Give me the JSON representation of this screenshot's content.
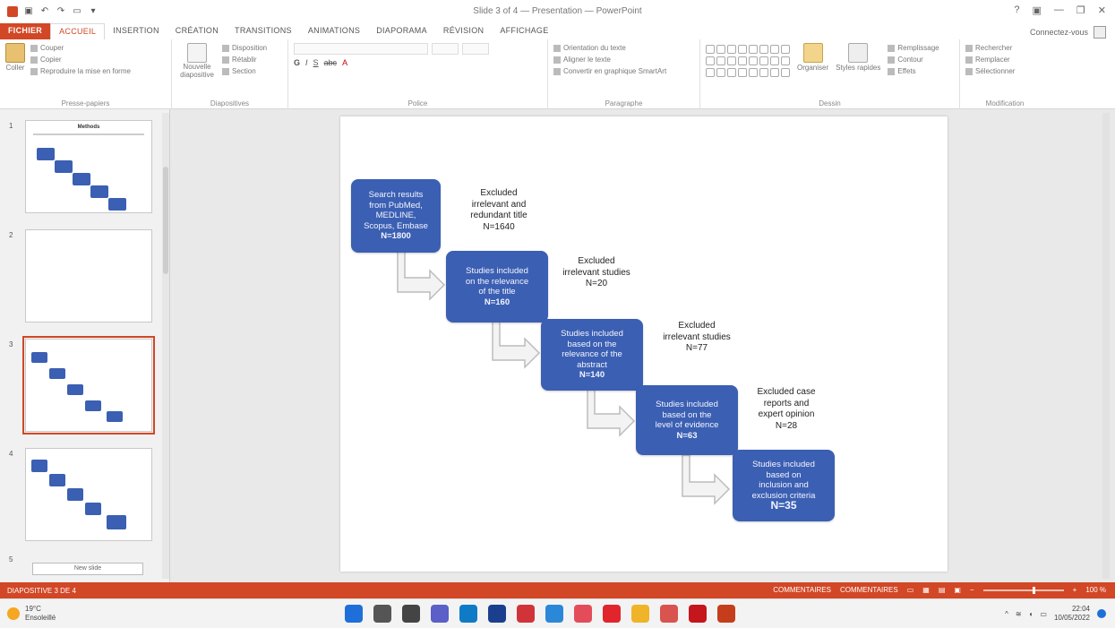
{
  "window": {
    "title": "Slide 3 of 4 — Presentation — PowerPoint",
    "qat": [
      "save-icon",
      "undo-icon",
      "redo-icon",
      "start-icon",
      "customize-icon"
    ],
    "controls": [
      "help-icon",
      "ribbon-options-icon",
      "minimize-icon",
      "restore-icon",
      "close-icon"
    ]
  },
  "tabs": {
    "file": "FICHIER",
    "items": [
      "ACCUEIL",
      "INSERTION",
      "CRÉATION",
      "TRANSITIONS",
      "ANIMATIONS",
      "DIAPORAMA",
      "RÉVISION",
      "AFFICHAGE"
    ],
    "active": "ACCUEIL",
    "account": "Connectez-vous"
  },
  "ribbon": {
    "clipboard": {
      "paste": "Coller",
      "cut": "Couper",
      "copy": "Copier",
      "painter": "Reproduire la mise en forme",
      "label": "Presse-papiers"
    },
    "slides": {
      "new": "Nouvelle diapositive",
      "layout": "Disposition",
      "reset": "Rétablir",
      "section": "Section",
      "label": "Diapositives"
    },
    "font": {
      "label": "Police"
    },
    "paragraph": {
      "dir": "Orientation du texte",
      "align": "Aligner le texte",
      "smartart": "Convertir en graphique SmartArt",
      "label": "Paragraphe"
    },
    "drawing": {
      "arrange": "Organiser",
      "styles": "Styles rapides",
      "fill": "Remplissage",
      "outline": "Contour",
      "effects": "Effets",
      "label": "Dessin"
    },
    "editing": {
      "find": "Rechercher",
      "replace": "Remplacer",
      "select": "Sélectionner",
      "label": "Modification"
    }
  },
  "thumbnails": {
    "numbers": [
      "1",
      "2",
      "3",
      "4",
      "5"
    ],
    "slide1_title": "Methods",
    "new_slide": "New slide"
  },
  "flowchart": {
    "boxes": [
      {
        "lines": [
          "Search results",
          "from PubMed,",
          "MEDLINE,",
          "Scopus, Embase"
        ],
        "n": "N=1800"
      },
      {
        "lines": [
          "Studies included",
          "on the relevance",
          "of the title"
        ],
        "n": "N=160"
      },
      {
        "lines": [
          "Studies included",
          "based on the",
          "relevance of the",
          "abstract"
        ],
        "n": "N=140"
      },
      {
        "lines": [
          "Studies included",
          "based on the",
          "level of evidence"
        ],
        "n": "N=63"
      },
      {
        "lines": [
          "Studies included",
          "based on",
          "inclusion and",
          "exclusion criteria"
        ],
        "n": "N=35"
      }
    ],
    "exclusions": [
      [
        "Excluded",
        "irrelevant and",
        "redundant title",
        "N=1640"
      ],
      [
        "Excluded",
        "irrelevant studies",
        "N=20"
      ],
      [
        "Excluded",
        "irrelevant studies",
        "N=77"
      ],
      [
        "Excluded case",
        "reports and",
        "expert opinion",
        "N=28"
      ]
    ]
  },
  "status": {
    "slide_info": "DIAPOSITIVE 3 DE 4",
    "notes": "COMMENTAIRES",
    "comments": "COMMENTAIRES",
    "zoom": "100 %"
  },
  "taskbar": {
    "temp": "19°C",
    "weather": "Ensoleillé",
    "time": "22:04",
    "date": "10/05/2022",
    "apps": [
      {
        "icon": "windows-start-icon",
        "color": "#1e6fd9"
      },
      {
        "icon": "search-icon",
        "color": "#555555"
      },
      {
        "icon": "file-explorer-icon",
        "color": "#444444"
      },
      {
        "icon": "chat-icon",
        "color": "#5b5fc7"
      },
      {
        "icon": "edge-icon",
        "color": "#0f7bc6"
      },
      {
        "icon": "store-icon",
        "color": "#1b3f8f"
      },
      {
        "icon": "app-red-icon",
        "color": "#d13438"
      },
      {
        "icon": "shield-icon",
        "color": "#2b88d8"
      },
      {
        "icon": "pocket-icon",
        "color": "#e34d59"
      },
      {
        "icon": "opera-icon",
        "color": "#e0252d"
      },
      {
        "icon": "folder-icon",
        "color": "#f0b429"
      },
      {
        "icon": "media-icon",
        "color": "#d9534f"
      },
      {
        "icon": "acrobat-icon",
        "color": "#c4161c"
      },
      {
        "icon": "powerpoint-icon",
        "color": "#c43e1c"
      }
    ]
  }
}
